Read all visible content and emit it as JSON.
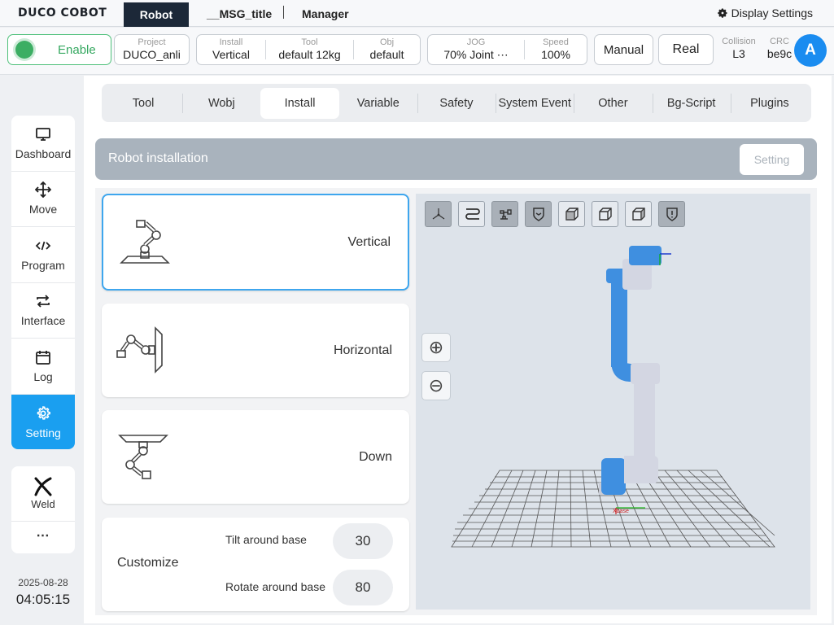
{
  "app": {
    "logo": "DUCO COBOT"
  },
  "header": {
    "tabs": {
      "robot": "Robot",
      "msg": "__MSG_title",
      "manager": "Manager"
    },
    "display_settings": "Display Settings"
  },
  "status": {
    "enable": "Enable",
    "project": {
      "key": "Project",
      "value": "DUCO_anli"
    },
    "install": {
      "key": "Install",
      "value": "Vertical"
    },
    "tool": {
      "key": "Tool",
      "value": "default  12kg"
    },
    "obj": {
      "key": "Obj",
      "value": "default"
    },
    "jog": {
      "key": "JOG",
      "value": "70%   Joint ⋯"
    },
    "speed": {
      "key": "Speed",
      "value": "100%"
    },
    "manual": "Manual",
    "real": "Real",
    "collision": {
      "key": "Collision",
      "value": "L3"
    },
    "crc": {
      "key": "CRC",
      "value": "be9c"
    },
    "avatar": "A"
  },
  "sidebar": {
    "items": [
      {
        "label": "Dashboard",
        "icon": "monitor-icon"
      },
      {
        "label": "Move",
        "icon": "move-icon"
      },
      {
        "label": "Program",
        "icon": "code-icon"
      },
      {
        "label": "Interface",
        "icon": "swap-icon"
      },
      {
        "label": "Log",
        "icon": "calendar-icon"
      },
      {
        "label": "Setting",
        "icon": "gear-icon"
      }
    ],
    "weld": "Weld",
    "more": "⋯",
    "date": "2025-08-28",
    "time": "04:05:15"
  },
  "tabs": [
    "Tool",
    "Wobj",
    "Install",
    "Variable",
    "Safety",
    "System Event",
    "Other",
    "Bg-Script",
    "Plugins"
  ],
  "active_tab": "Install",
  "section": {
    "title": "Robot installation",
    "setting": "Setting"
  },
  "install_options": {
    "vertical": "Vertical",
    "horizontal": "Horizontal",
    "down": "Down",
    "customize": "Customize",
    "selected": "Vertical"
  },
  "customize": {
    "tilt_label": "Tilt around base",
    "tilt_value": "30",
    "rotate_label": "Rotate around base",
    "rotate_value": "80"
  },
  "viewer": {
    "zoom_in": "⊕",
    "zoom_out": "⊖",
    "axis_label": "Xbase",
    "toolbar": [
      "axes-icon",
      "path-icon",
      "robot-icon",
      "shield-icon",
      "cube-view-icon",
      "cube-view-icon",
      "cube-view-icon",
      "shield-alert-icon"
    ]
  },
  "colors": {
    "accent": "#1a9ff0",
    "enable": "#3cae63",
    "robot_blue": "#3f8fe0"
  }
}
